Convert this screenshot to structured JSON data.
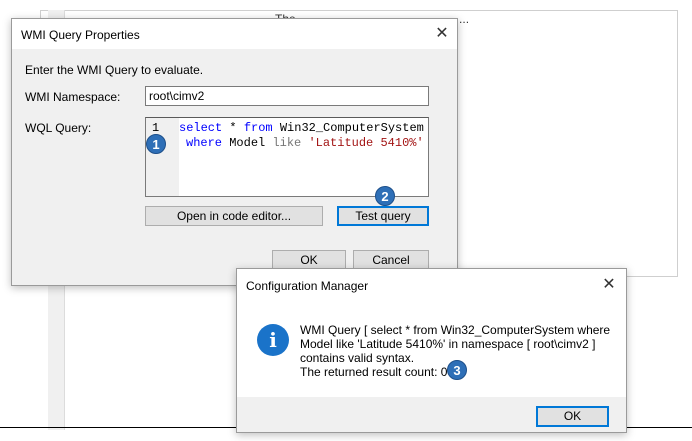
{
  "background": {
    "partial_text": "The ...... ............ ... ... ...... .. ...... ......"
  },
  "wmi_dialog": {
    "title": "WMI Query Properties",
    "close_glyph": "✕",
    "prompt": "Enter the WMI Query to evaluate.",
    "namespace_label": "WMI Namespace:",
    "namespace_value": "root\\cimv2",
    "wql_label": "WQL Query:",
    "query": {
      "line_number": "1",
      "line1": {
        "kw1": "select",
        "op": " * ",
        "kw2": "from",
        "rest": " Win32_ComputerSystem"
      },
      "line2": {
        "kw1": "where",
        "ident": " Model ",
        "kw2": "like",
        "str": " 'Latitude 5410%'"
      }
    },
    "open_editor_label": "Open in code editor...",
    "test_query_label": "Test query",
    "ok_label": "OK",
    "cancel_label": "Cancel"
  },
  "cm_dialog": {
    "title": "Configuration Manager",
    "close_glyph": "✕",
    "info_glyph": "i",
    "message_lines": [
      "WMI Query [ select * from Win32_ComputerSystem where",
      "Model like 'Latitude 5410%'  in namespace [ root\\cimv2 ]",
      "contains valid syntax.",
      "The returned result count: 0"
    ],
    "ok_label": "OK"
  },
  "callouts": [
    "1",
    "2",
    "3"
  ],
  "colors": {
    "accent": "#0078d7",
    "badge": "#2e6fb7",
    "keyword": "#0000ff",
    "string": "#a31515",
    "info": "#1a73c9"
  }
}
